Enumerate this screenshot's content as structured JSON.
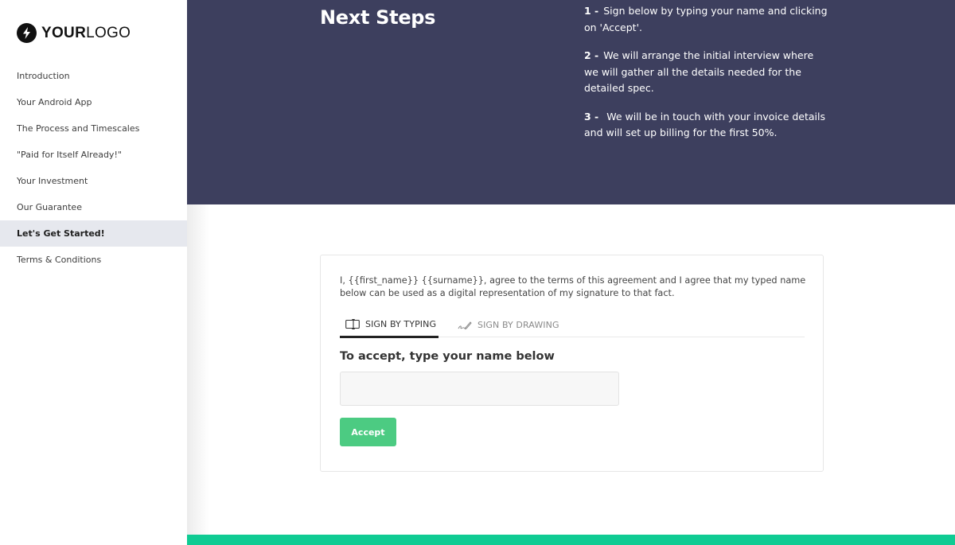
{
  "logo": {
    "bold": "YOUR",
    "light": "LOGO",
    "icon": "lightning-bolt-icon"
  },
  "sidebar": {
    "items": [
      {
        "label": "Introduction",
        "active": false
      },
      {
        "label": "Your Android App",
        "active": false
      },
      {
        "label": "The Process and Timescales",
        "active": false
      },
      {
        "label": "\"Paid for Itself Already!\"",
        "active": false
      },
      {
        "label": "Your Investment",
        "active": false
      },
      {
        "label": "Our Guarantee",
        "active": false
      },
      {
        "label": "Let's Get Started!",
        "active": true
      },
      {
        "label": "Terms & Conditions",
        "active": false
      }
    ]
  },
  "hero": {
    "title": "Next Steps",
    "steps": [
      {
        "num": "1  -",
        "text": "Sign below by typing your name and clicking on 'Accept'."
      },
      {
        "num": "2  -",
        "text": "We will arrange the initial interview where we will gather all the details needed for the detailed spec."
      },
      {
        "num": "3  -",
        "text": " We will be in touch with your invoice details and will set up billing for the first 50%."
      }
    ]
  },
  "signature": {
    "agreement": "I, {{first_name}} {{surname}}, agree to the terms of this agreement and I agree that my typed name below can be used as a digital representation of my signature to that fact.",
    "tabs": [
      {
        "label": "Sign by typing",
        "icon": "text-cursor-box-icon",
        "active": true
      },
      {
        "label": "Sign by drawing",
        "icon": "signature-pen-icon",
        "active": false
      }
    ],
    "prompt": "To accept, type your name below",
    "input_value": "",
    "input_placeholder": "",
    "accept_label": "Accept"
  },
  "colors": {
    "hero_bg": "#3d3f5e",
    "accent_green": "#4ccb82",
    "footer_bar": "#0fcb93",
    "active_nav_bg": "#e6e8ee"
  }
}
